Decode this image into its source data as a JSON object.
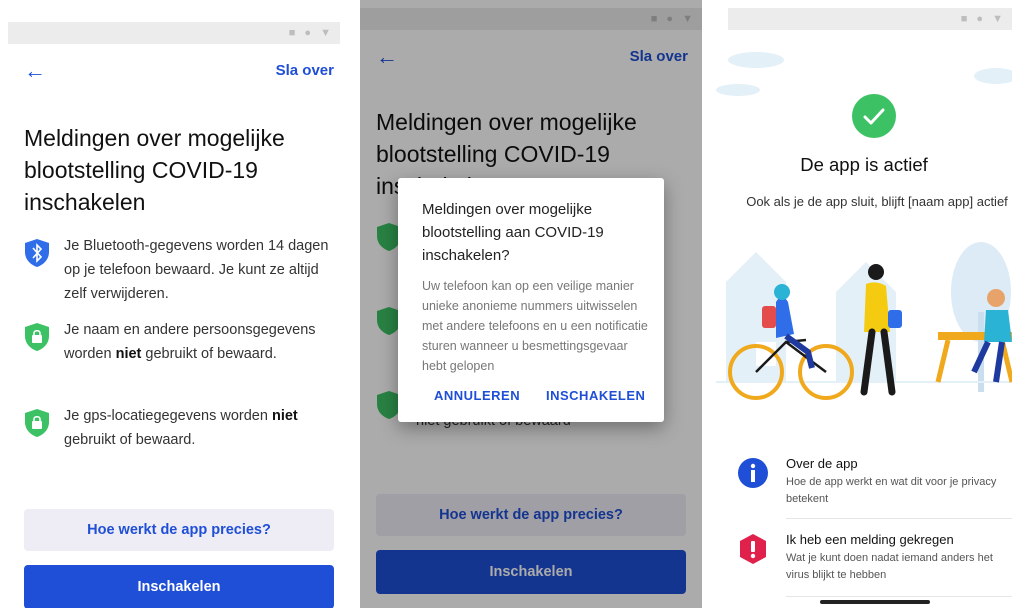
{
  "screen1": {
    "skip_label": "Sla over",
    "title": "Meldingen over mogelijke blootstelling COVID-19 inschakelen",
    "items": [
      {
        "icon": "bluetooth-shield-icon",
        "text": "Je Bluetooth-gegevens worden 14 dagen op je telefoon bewaard. Je kunt ze altijd zelf verwijderen.",
        "bold": ""
      },
      {
        "icon": "lock-shield-icon",
        "text": "Je naam en andere persoonsgegevens worden",
        "bold": "niet",
        "text_after": " gebruikt of bewaard."
      },
      {
        "icon": "lock-shield-icon",
        "text": "Je gps-locatiegegevens worden",
        "bold": "niet",
        "text_after": " gebruikt of bewaard."
      }
    ],
    "how_button": "Hoe werkt de app precies?",
    "enable_button": "Inschakelen"
  },
  "screen2": {
    "skip_label": "Sla over",
    "title": "Meldingen over mogelijke blootstelling COVID-19 inschakelen",
    "bg_partial_text": "niet gebruikt of bewaard",
    "dialog": {
      "title": "Meldingen over mogelijke blootstelling aan COVID-19 inschakelen?",
      "body": "Uw telefoon kan op een veilige manier unieke anonieme nummers uitwisselen met andere telefoons en u een notificatie sturen wanneer u besmettingsgevaar hebt gelopen",
      "cancel": "ANNULEREN",
      "confirm": "INSCHAKELEN"
    },
    "how_button": "Hoe werkt de app precies?",
    "enable_button": "Inschakelen"
  },
  "screen3": {
    "title": "De app is actief",
    "subtitle": "Ook als je de app sluit, blijft [naam app] actief",
    "rows": [
      {
        "icon": "info-icon",
        "title": "Over de app",
        "desc": "Hoe de app werkt en wat dit voor je privacy betekent",
        "color": "#1f4fd6"
      },
      {
        "icon": "alert-icon",
        "title": "Ik heb een melding gekregen",
        "desc": "Wat je kunt doen nadat iemand anders het virus blijkt te hebben",
        "color": "#e0214c"
      }
    ]
  },
  "colors": {
    "primary": "#1f4fd6",
    "success": "#3cc265",
    "alert": "#e0214c",
    "secondary_bg": "#eeedf6"
  }
}
